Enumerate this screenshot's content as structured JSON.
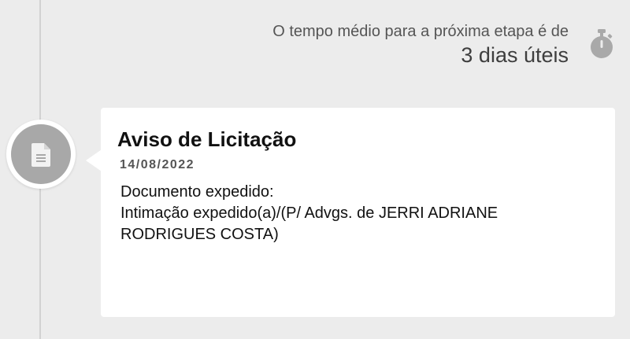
{
  "eta": {
    "label": "O tempo médio para a próxima etapa é de",
    "value": "3 dias úteis",
    "icon": "stopwatch-icon"
  },
  "event": {
    "icon": "document-icon",
    "title": "Aviso de Licitação",
    "date": "14/08/2022",
    "body_lines": [
      "Documento expedido:",
      "Intimação expedido(a)/(P/ Advgs. de JERRI ADRIANE",
      "RODRIGUES COSTA)"
    ]
  },
  "colors": {
    "background": "#ececec",
    "card": "#ffffff",
    "node": "#a8a8a8",
    "icon_gray": "#a9a9a9"
  }
}
